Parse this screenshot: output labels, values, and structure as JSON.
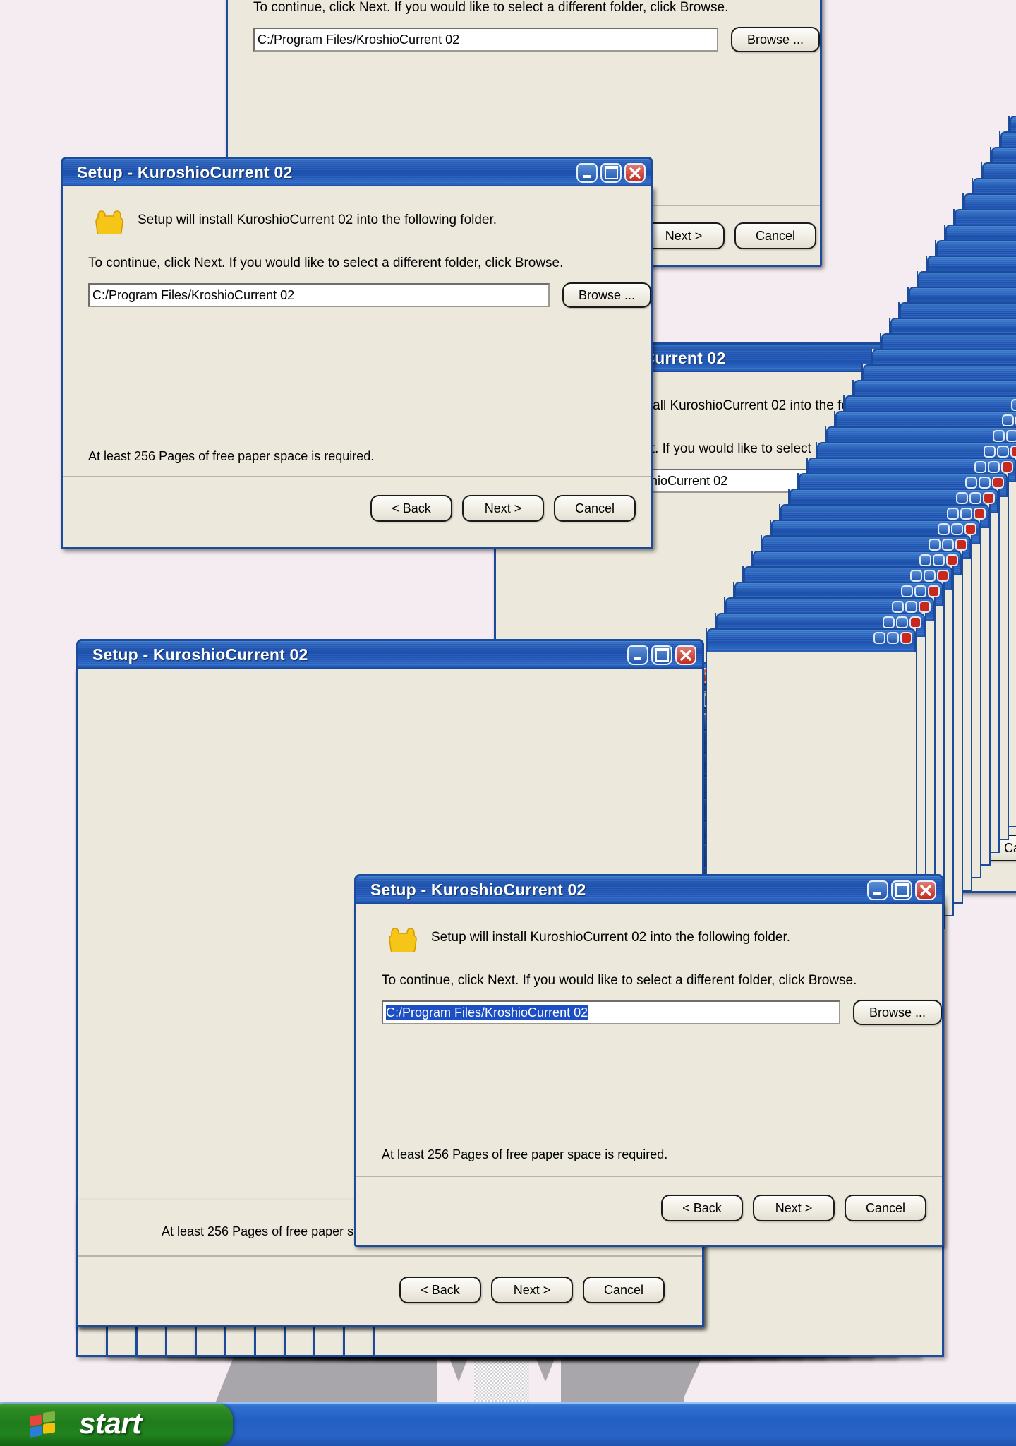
{
  "desktop": {
    "background_color": "#f5ecf2"
  },
  "dialog": {
    "title": "Setup - KuroshioCurrent 02",
    "heading": "Setup will install KuroshioCurrent 02 into the following folder.",
    "paragraph": "To continue, click Next. If you would like to select a different folder, click Browse.",
    "path_value": "C:/Program Files/KroshioCurrent 02",
    "path_placeholder": "C:/Program Files/KroshioCurrent 02",
    "browse_label": "Browse ...",
    "status": "At least 256 Pages of free paper space is required.",
    "back_label": "< Back",
    "next_label": "Next >",
    "cancel_label": "Cancel",
    "folder_icon": "folder-icon",
    "minimize_icon": "minimize-icon",
    "maximize_icon": "maximize-icon",
    "close_icon": "close-icon"
  },
  "windows": [
    {
      "id": "top-partial",
      "title": "Setup - KuroshioCurrent 02"
    },
    {
      "id": "main-floating",
      "title": "Setup - KuroshioCurrent 02"
    },
    {
      "id": "mid-right",
      "title": "Setup - KuroshioCurrent 02"
    },
    {
      "id": "bottom-large",
      "title": "Setup - KuroshioCurrent 02"
    },
    {
      "id": "bottom-front",
      "title": "Setup - KuroshioCurrent 02"
    }
  ],
  "cascade_titles": [
    "Setup - KuroshioCurrent 02",
    "Setup - KuroshioCurrent 02",
    "Setup - KuroshioCurrent 02",
    "Setup - KuroshioCurrent 02",
    "Setup - KuroshioCurrent 02",
    "Setup - KuroshioCurrent 02",
    "Setup - KuroshioCurrent 02",
    "Setup - KuroshioCurrent 02",
    "Setup - KuroshioCurrent 02",
    "Setup - KuroshioCurrent 02",
    "Setup - KuroshioCurrent 02"
  ],
  "taskbar": {
    "start_label": "start",
    "start_icon": "windows-flag-icon",
    "start_color": "#1f7d1c",
    "bar_color": "#245fc4"
  },
  "colors": {
    "titlebar_blue": "#1e54b4",
    "window_face": "#ece9dc",
    "close_red": "#c32a1e",
    "selection_blue": "#1c4fc4",
    "folder_yellow": "#f5c518"
  }
}
